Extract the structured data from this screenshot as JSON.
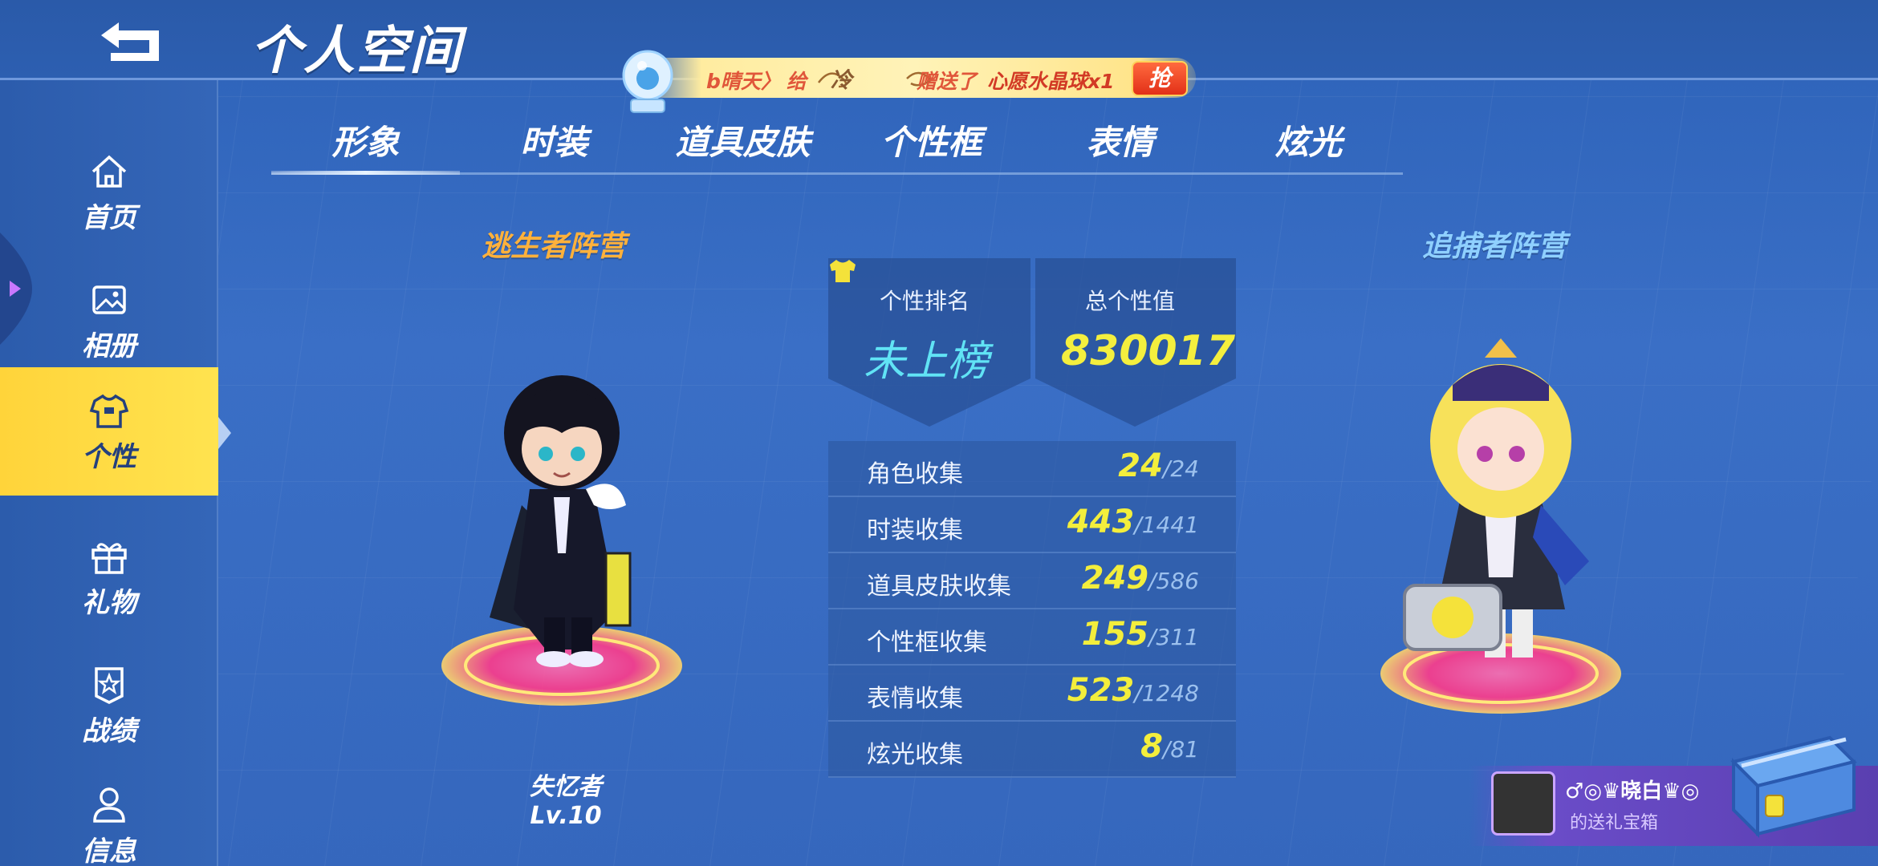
{
  "header": {
    "title": "个人空间"
  },
  "banner": {
    "sender": "b晴天〉",
    "give": "给",
    "receiver": "冷",
    "sent": "赠送了",
    "gift": "心愿水晶球x1",
    "grab": "抢"
  },
  "sidebar": {
    "items": [
      {
        "label": "首页",
        "icon": "home-icon"
      },
      {
        "label": "相册",
        "icon": "image-icon"
      },
      {
        "label": "个性",
        "icon": "shirt-icon"
      },
      {
        "label": "礼物",
        "icon": "gift-icon"
      },
      {
        "label": "战绩",
        "icon": "medal-icon"
      },
      {
        "label": "信息",
        "icon": "user-icon"
      }
    ],
    "active_index": 2
  },
  "tabs": [
    {
      "label": "形象"
    },
    {
      "label": "时装"
    },
    {
      "label": "道具皮肤"
    },
    {
      "label": "个性框"
    },
    {
      "label": "表情"
    },
    {
      "label": "炫光"
    }
  ],
  "active_tab": 0,
  "camps": {
    "left": "逃生者阵营",
    "right": "追捕者阵营"
  },
  "character": {
    "name": "失忆者",
    "level": "Lv.10"
  },
  "ranking": {
    "rank_label": "个性排名",
    "rank_value": "未上榜",
    "total_label": "总个性值",
    "total_value": "830017"
  },
  "stats": [
    {
      "name": "角色收集",
      "current": "24",
      "total": "24"
    },
    {
      "name": "时装收集",
      "current": "443",
      "total": "1441"
    },
    {
      "name": "道具皮肤收集",
      "current": "249",
      "total": "586"
    },
    {
      "name": "个性框收集",
      "current": "155",
      "total": "311"
    },
    {
      "name": "表情收集",
      "current": "523",
      "total": "1248"
    },
    {
      "name": "炫光收集",
      "current": "8",
      "total": "81"
    }
  ],
  "gift_box": {
    "user": "♂◎♛晓白♛◎",
    "subtitle": "的送礼宝箱"
  },
  "colors": {
    "accent_yellow": "#ffd43a",
    "value_yellow": "#f3ee3c",
    "rank_cyan": "#61e3f5",
    "camp_orange": "#ffb13b",
    "camp_blue": "#8fd0ff"
  }
}
